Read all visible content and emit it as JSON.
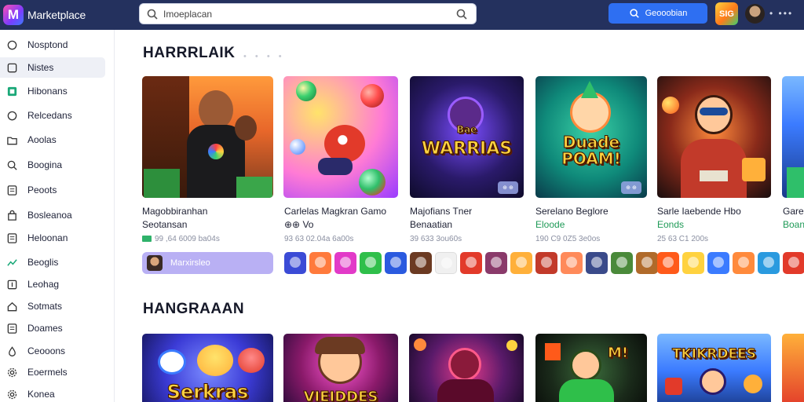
{
  "app": {
    "logo_letter": "M",
    "name": "Marketplace"
  },
  "search": {
    "value": "Imoeplacan"
  },
  "top_search_button": {
    "label": "Geooobian"
  },
  "top_app_icon": {
    "label": "SIG"
  },
  "top_more": "• •••",
  "sidebar": {
    "items": [
      {
        "label": "Nosptond",
        "icon": "circle-icon"
      },
      {
        "label": "Nistes",
        "icon": "square-icon"
      },
      {
        "label": "Hibonans",
        "icon": "grid-icon"
      },
      {
        "label": "Relcedans",
        "icon": "circle-icon"
      },
      {
        "label": "Aoolas",
        "icon": "folder-icon"
      },
      {
        "label": "Boogina",
        "icon": "search-icon"
      },
      {
        "label": "Peoots",
        "icon": "list-icon"
      },
      {
        "label": "Bosleanoa",
        "icon": "bag-icon"
      },
      {
        "label": "Heloonan",
        "icon": "list-icon"
      },
      {
        "label": "Beoglis",
        "icon": "trend-icon"
      },
      {
        "label": "Leohag",
        "icon": "tag-icon"
      },
      {
        "label": "Sotmats",
        "icon": "house-icon"
      },
      {
        "label": "Doames",
        "icon": "list-icon"
      },
      {
        "label": "Ceooons",
        "icon": "drop-icon"
      },
      {
        "label": "Eoermels",
        "icon": "gear-icon"
      },
      {
        "label": "Konea",
        "icon": "gear-icon"
      }
    ]
  },
  "sections": [
    {
      "title": "HARRRLAIK",
      "dots": "• • • •"
    },
    {
      "title": "HANGRAAAN"
    }
  ],
  "cards": [
    {
      "title": "Magobbiranhan",
      "subtitle": "Seotansan",
      "meta": "99 ,64 6009 ba04s",
      "image_text": "",
      "badge": ""
    },
    {
      "title": "Carlelas Magkran Gamo",
      "subtitle": "⊕⊕ Vo",
      "meta": "93 63 02.04a 6a00s",
      "image_text": "",
      "badge": ""
    },
    {
      "title": "Majofians Tner",
      "subtitle": "Benaatian",
      "meta": "39 633 3ou60s",
      "image_text": "WARRIAS",
      "image_text_top": "Bae",
      "badge": "⊕ ⊕"
    },
    {
      "title": "Serelano Beglore",
      "subtitle": "Eloode",
      "meta": "190 C9 0Z5 3e0os",
      "image_text": "Duade POAM!",
      "badge": "⊕ ⊕"
    },
    {
      "title": "Sarle Iaebende Hbo",
      "subtitle": "Eonds",
      "meta": "25 63 C1 200s",
      "image_text": "",
      "badge": ""
    },
    {
      "title": "Gare",
      "subtitle": "Boan",
      "meta": "",
      "image_text": "",
      "badge": ""
    }
  ],
  "pill_button": {
    "label": "Marxirsleo"
  },
  "bottom_cards": [
    {
      "image_text": "Serkras"
    },
    {
      "image_text": "VIEIDDES"
    },
    {
      "image_text": ""
    },
    {
      "image_text": "M!"
    },
    {
      "image_text": "TKIKRDEES"
    },
    {
      "image_text": ""
    }
  ],
  "colors": {
    "topbar": "#24315e",
    "accent": "#2e6ff2",
    "pill": "#b9b0f4",
    "green": "#1f9a57"
  }
}
